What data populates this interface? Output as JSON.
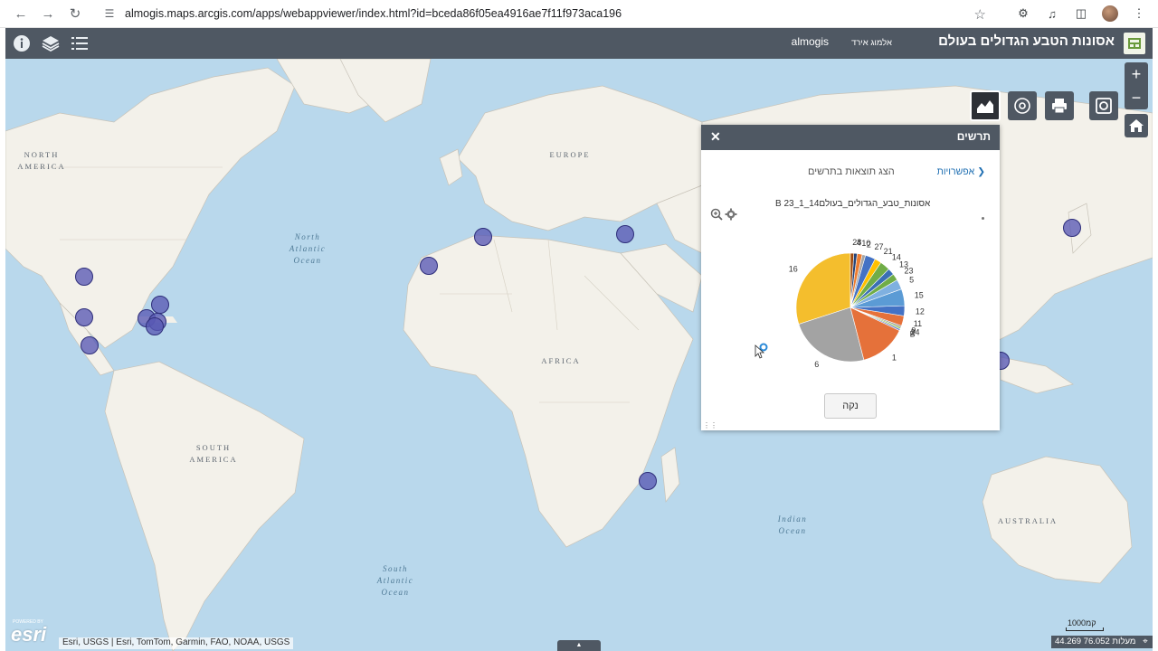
{
  "browser": {
    "url": "almogis.maps.arcgis.com/apps/webappviewer/index.html?id=bceda86f05ea4916ae7f11f973aca196"
  },
  "header": {
    "title": "אסונות הטבע הגדולים בעולם",
    "user_link": "אלמוג אירד",
    "org": "almogis"
  },
  "map": {
    "labels": {
      "north_america": "NORTH AMERICA",
      "south_america": "SOUTH AMERICA",
      "europe": "EUROPE",
      "africa": "AFRICA",
      "australia": "AUSTRALIA",
      "north_atlantic": "North Atlantic Ocean",
      "south_atlantic": "South Atlantic Ocean",
      "indian": "Indian Ocean"
    },
    "attribution": "Esri, USGS | Esri, TomTom, Garmin, FAO, NOAA, USGS",
    "esri_logo": "esri",
    "esri_powered": "POWERED BY",
    "scale": "1000קמ",
    "coordinates": "44.269 76.052 מעלות",
    "accent": "#4f5863",
    "marker_color": "#5858b4"
  },
  "chart_panel": {
    "title": "תרשים",
    "options_link": "אפשרויות",
    "results_text": "הצג תוצאות בתרשים",
    "chart_title": "אסונות_טבע_הגדולים_בעולם14_1_23 B",
    "clear_button": "נקה",
    "icons": [
      "zoom-icon",
      "gear-icon",
      "close-icon"
    ]
  },
  "chart_data": {
    "type": "pie",
    "title": "",
    "categories": [
      "16",
      "6",
      "1",
      "B",
      "24",
      "9",
      "11",
      "12",
      "15",
      "5",
      "23",
      "13",
      "14",
      "21",
      "27",
      "2",
      "10",
      "4",
      "28"
    ],
    "values": [
      30,
      24,
      14,
      0.5,
      0.5,
      0.5,
      3,
      3,
      5,
      3,
      2,
      2,
      3,
      2,
      3,
      1,
      1.5,
      1,
      1
    ],
    "colors": [
      "#f4be2d",
      "#a3a3a3",
      "#e5713a",
      "#5c6fc4",
      "#8bc34a",
      "#888888",
      "#e5713a",
      "#4472c4",
      "#5b9bd5",
      "#7fb0e0",
      "#70ad47",
      "#3a6fb5",
      "#70ad47",
      "#ffc000",
      "#4472c4",
      "#a5a5a5",
      "#ed7d31",
      "#264478",
      "#9e480e"
    ]
  }
}
